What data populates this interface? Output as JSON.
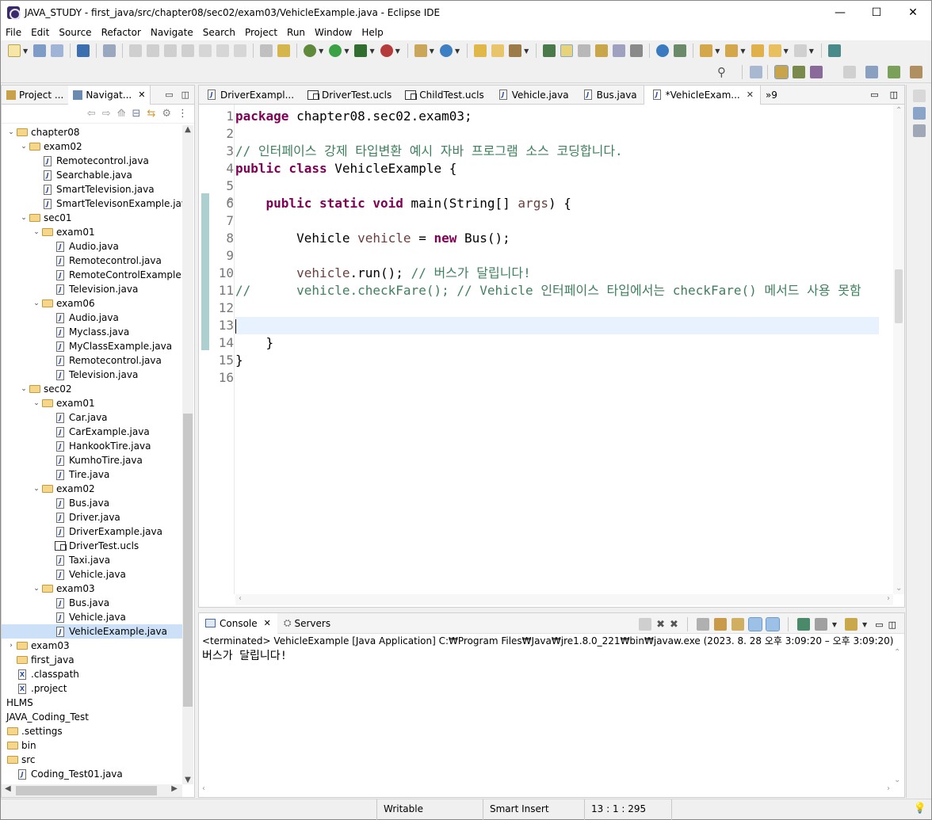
{
  "window": {
    "title": "JAVA_STUDY - first_java/src/chapter08/sec02/exam03/VehicleExample.java - Eclipse IDE",
    "minimize": "—",
    "maximize": "☐",
    "close": "✕"
  },
  "menu": [
    "File",
    "Edit",
    "Source",
    "Refactor",
    "Navigate",
    "Search",
    "Project",
    "Run",
    "Window",
    "Help"
  ],
  "left_panel": {
    "tabs": [
      {
        "label": "Project ...",
        "active": false
      },
      {
        "label": "Navigat...",
        "active": true
      }
    ],
    "tree": [
      {
        "label": "chapter08",
        "depth": 0,
        "type": "folder",
        "expanded": true
      },
      {
        "label": "exam02",
        "depth": 1,
        "type": "folder",
        "expanded": true
      },
      {
        "label": "Remotecontrol.java",
        "depth": 2,
        "type": "java"
      },
      {
        "label": "Searchable.java",
        "depth": 2,
        "type": "java"
      },
      {
        "label": "SmartTelevision.java",
        "depth": 2,
        "type": "java"
      },
      {
        "label": "SmartTelevisonExample.java",
        "depth": 2,
        "type": "java"
      },
      {
        "label": "sec01",
        "depth": 1,
        "type": "folder",
        "expanded": true
      },
      {
        "label": "exam01",
        "depth": 2,
        "type": "folder",
        "expanded": true
      },
      {
        "label": "Audio.java",
        "depth": 3,
        "type": "java"
      },
      {
        "label": "Remotecontrol.java",
        "depth": 3,
        "type": "java"
      },
      {
        "label": "RemoteControlExample.ja",
        "depth": 3,
        "type": "java"
      },
      {
        "label": "Television.java",
        "depth": 3,
        "type": "java"
      },
      {
        "label": "exam06",
        "depth": 2,
        "type": "folder",
        "expanded": true
      },
      {
        "label": "Audio.java",
        "depth": 3,
        "type": "java"
      },
      {
        "label": "Myclass.java",
        "depth": 3,
        "type": "java"
      },
      {
        "label": "MyClassExample.java",
        "depth": 3,
        "type": "java"
      },
      {
        "label": "Remotecontrol.java",
        "depth": 3,
        "type": "java"
      },
      {
        "label": "Television.java",
        "depth": 3,
        "type": "java"
      },
      {
        "label": "sec02",
        "depth": 1,
        "type": "folder",
        "expanded": true
      },
      {
        "label": "exam01",
        "depth": 2,
        "type": "folder",
        "expanded": true
      },
      {
        "label": "Car.java",
        "depth": 3,
        "type": "java"
      },
      {
        "label": "CarExample.java",
        "depth": 3,
        "type": "java"
      },
      {
        "label": "HankookTire.java",
        "depth": 3,
        "type": "java"
      },
      {
        "label": "KumhoTire.java",
        "depth": 3,
        "type": "java"
      },
      {
        "label": "Tire.java",
        "depth": 3,
        "type": "java"
      },
      {
        "label": "exam02",
        "depth": 2,
        "type": "folder",
        "expanded": true
      },
      {
        "label": "Bus.java",
        "depth": 3,
        "type": "java"
      },
      {
        "label": "Driver.java",
        "depth": 3,
        "type": "java"
      },
      {
        "label": "DriverExample.java",
        "depth": 3,
        "type": "java"
      },
      {
        "label": "DriverTest.ucls",
        "depth": 3,
        "type": "ucls"
      },
      {
        "label": "Taxi.java",
        "depth": 3,
        "type": "java"
      },
      {
        "label": "Vehicle.java",
        "depth": 3,
        "type": "java"
      },
      {
        "label": "exam03",
        "depth": 2,
        "type": "folder",
        "expanded": true
      },
      {
        "label": "Bus.java",
        "depth": 3,
        "type": "java"
      },
      {
        "label": "Vehicle.java",
        "depth": 3,
        "type": "java"
      },
      {
        "label": "VehicleExample.java",
        "depth": 3,
        "type": "java",
        "selected": true
      },
      {
        "label": "exam03",
        "depth": 0,
        "type": "folder",
        "expanded": false
      },
      {
        "label": "first_java",
        "depth": 0,
        "type": "folder",
        "noTwisty": true
      },
      {
        "label": ".classpath",
        "depth": 0,
        "type": "file",
        "noTwisty": true
      },
      {
        "label": ".project",
        "depth": 0,
        "type": "file",
        "noTwisty": true
      },
      {
        "label": "HLMS",
        "depth": -1,
        "type": "none"
      },
      {
        "label": "JAVA_Coding_Test",
        "depth": -1,
        "type": "none"
      },
      {
        "label": ".settings",
        "depth": -1,
        "type": "folder"
      },
      {
        "label": "bin",
        "depth": -1,
        "type": "folder"
      },
      {
        "label": "src",
        "depth": -1,
        "type": "folder"
      },
      {
        "label": "Coding_Test01.java",
        "depth": 0,
        "type": "java",
        "noTwisty": true
      }
    ]
  },
  "editor": {
    "tabs": [
      {
        "label": "DriverExampl...",
        "icon": "java",
        "active": false
      },
      {
        "label": "DriverTest.ucls",
        "icon": "ucls",
        "active": false
      },
      {
        "label": "ChildTest.ucls",
        "icon": "ucls",
        "active": false
      },
      {
        "label": "Vehicle.java",
        "icon": "java",
        "active": false
      },
      {
        "label": "Bus.java",
        "icon": "java",
        "active": false
      },
      {
        "label": "*VehicleExam...",
        "icon": "java",
        "active": true
      }
    ],
    "overflow_label": "»9",
    "line_numbers": [
      "1",
      "2",
      "3",
      "4",
      "5",
      "6",
      "7",
      "8",
      "9",
      "10",
      "11",
      "12",
      "13",
      "14",
      "15",
      "16"
    ],
    "current_line": 13
  },
  "console": {
    "tabs": [
      {
        "label": "Console",
        "active": true
      },
      {
        "label": "Servers",
        "active": false
      }
    ],
    "status": "<terminated> VehicleExample [Java Application] C:₩Program Files₩Java₩jre1.8.0_221₩bin₩javaw.exe  (2023. 8. 28 오후 3:09:20 – 오후 3:09:20)",
    "output": "버스가 달립니다!"
  },
  "statusbar": {
    "writable": "Writable",
    "insert_mode": "Smart Insert",
    "position": "13 : 1 : 295"
  },
  "colors": {
    "keyword": "#7f0055",
    "comment": "#3f7f5f",
    "local_variable": "#6a3e3e",
    "current_line_bg": "#e8f2fe",
    "selection_bg": "#cce0f7"
  }
}
